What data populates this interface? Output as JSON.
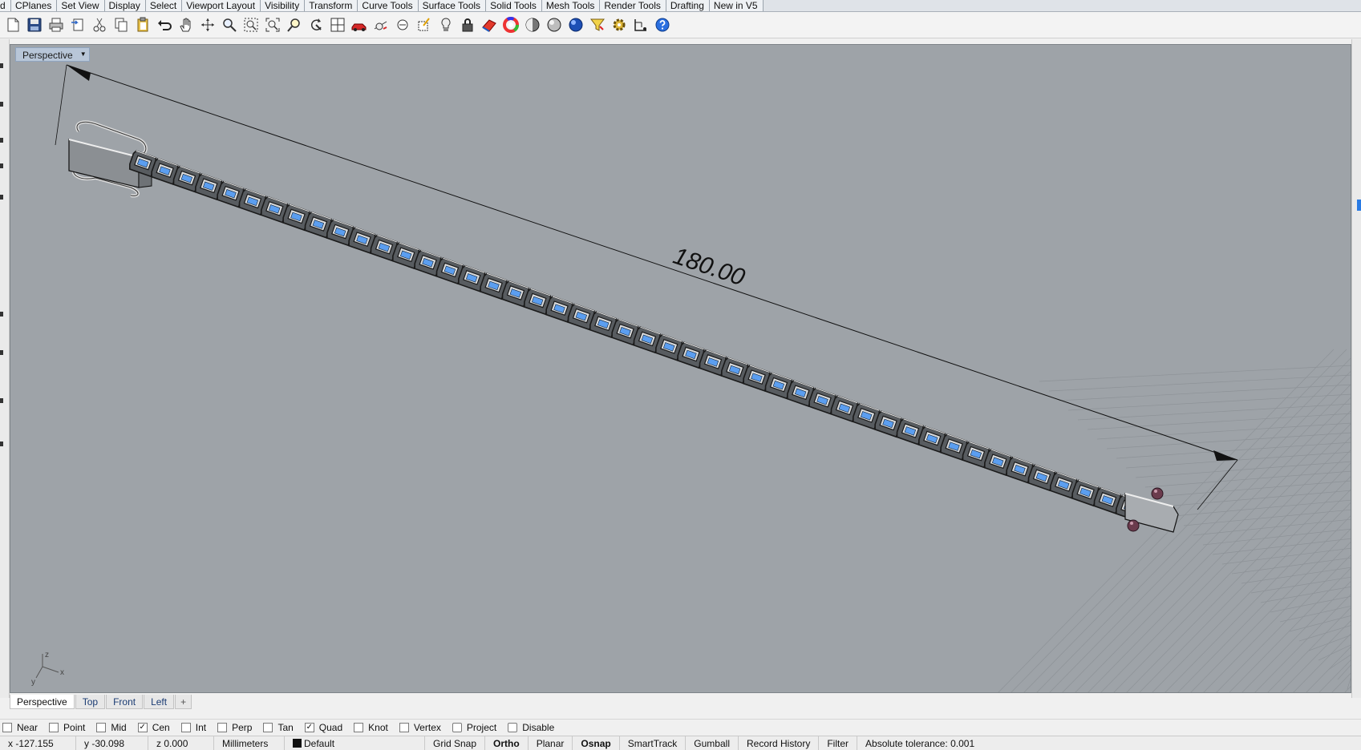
{
  "tabs": [
    "d",
    "CPlanes",
    "Set View",
    "Display",
    "Select",
    "Viewport Layout",
    "Visibility",
    "Transform",
    "Curve Tools",
    "Surface Tools",
    "Solid Tools",
    "Mesh Tools",
    "Render Tools",
    "Drafting",
    "New in V5"
  ],
  "toolbar": {
    "icons": [
      "new-icon",
      "save-icon",
      "print-icon",
      "import-icon",
      "cut-icon",
      "copy-icon",
      "paste-icon",
      "undo-icon",
      "pan-icon",
      "rotate-view-icon",
      "zoom-icon",
      "zoom-window-icon",
      "zoom-extents-icon",
      "zoom-selected-icon",
      "rotate-icon",
      "layout-icon",
      "car-icon",
      "measure-icon",
      "distance-icon",
      "snap-icon",
      "light-icon",
      "lock-icon",
      "surface-icon",
      "color-wheel-icon",
      "shade-icon",
      "sphere-icon",
      "render-sphere-icon",
      "filter-icon",
      "settings-icon",
      "dimension-icon",
      "help-icon"
    ]
  },
  "viewport": {
    "label": "Perspective",
    "dimension_text": "180.00",
    "colors": {
      "background": "#9ea3a8",
      "stone": "#5b9ef0",
      "link": "#1a1a1a"
    }
  },
  "axis": {
    "x": "x",
    "y": "y",
    "z": "z"
  },
  "viewport_tabs": [
    {
      "label": "Perspective",
      "active": true
    },
    {
      "label": "Top",
      "active": false
    },
    {
      "label": "Front",
      "active": false
    },
    {
      "label": "Left",
      "active": false
    }
  ],
  "add_tab_symbol": "+",
  "osnap": [
    {
      "label": "Near",
      "checked": false
    },
    {
      "label": "Point",
      "checked": false
    },
    {
      "label": "Mid",
      "checked": false
    },
    {
      "label": "Cen",
      "checked": true
    },
    {
      "label": "Int",
      "checked": false
    },
    {
      "label": "Perp",
      "checked": false
    },
    {
      "label": "Tan",
      "checked": false
    },
    {
      "label": "Quad",
      "checked": true
    },
    {
      "label": "Knot",
      "checked": false
    },
    {
      "label": "Vertex",
      "checked": false
    },
    {
      "label": "Project",
      "checked": false
    },
    {
      "label": "Disable",
      "checked": false
    }
  ],
  "status": {
    "x": "x -127.155",
    "y": "y -30.098",
    "z": "z 0.000",
    "units": "Millimeters",
    "layer": "Default",
    "grid_snap": "Grid Snap",
    "ortho": "Ortho",
    "planar": "Planar",
    "osnap": "Osnap",
    "smarttrack": "SmartTrack",
    "gumball": "Gumball",
    "record_history": "Record History",
    "filter": "Filter",
    "tolerance": "Absolute tolerance: 0.001"
  }
}
